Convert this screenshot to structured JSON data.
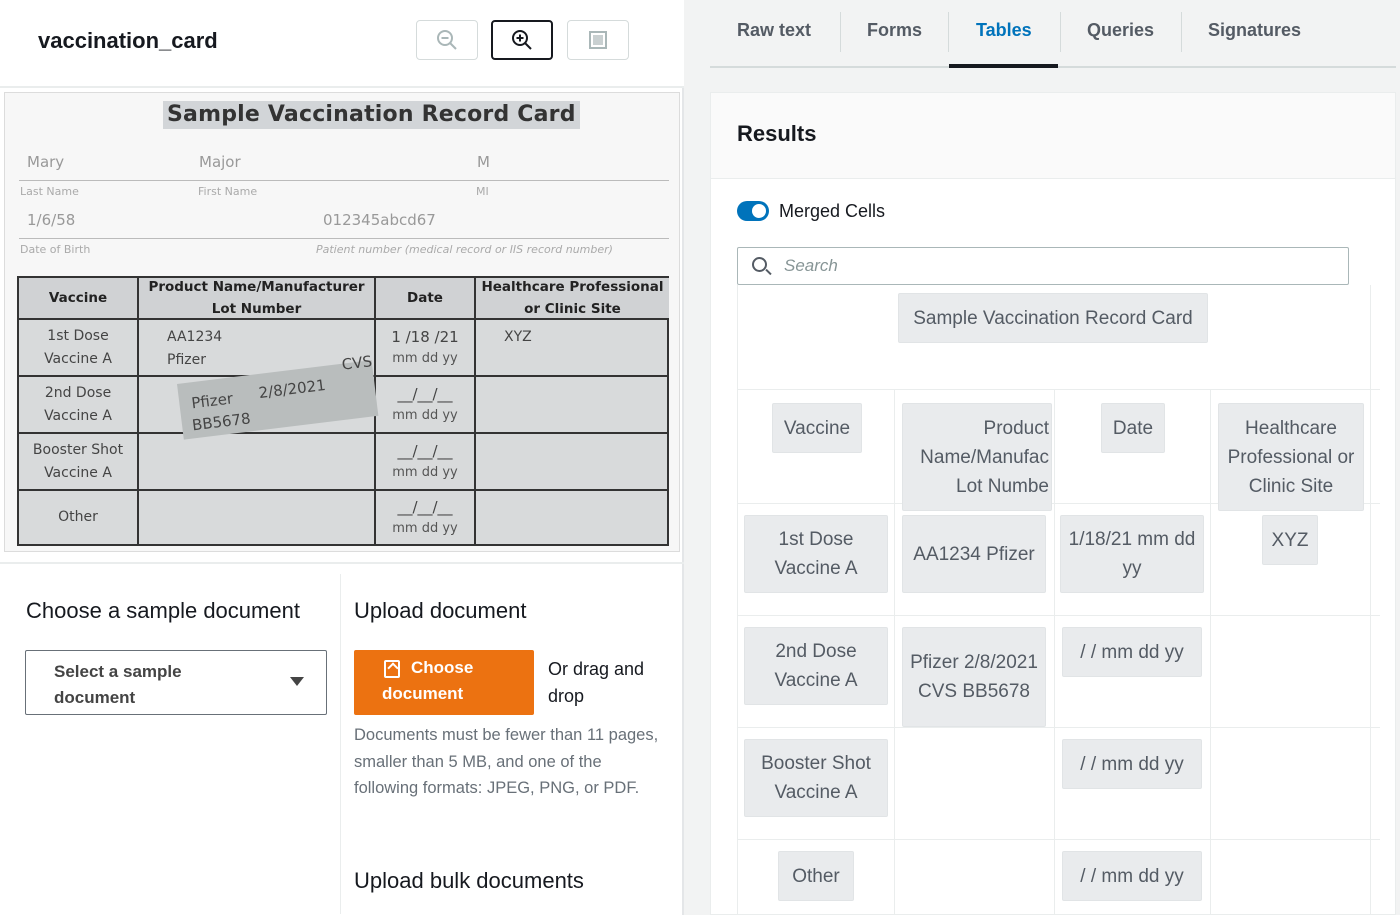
{
  "document": {
    "name": "vaccination_card",
    "toolbar": {
      "zoom_out_icon": "zoom-out-icon",
      "zoom_in_icon": "zoom-in-icon",
      "fit_icon": "fit-page-icon"
    }
  },
  "card": {
    "title": "Sample Vaccination Record Card",
    "last_name_value": "Mary",
    "first_name_value": "Major",
    "mi_value": "M",
    "last_name_label": "Last Name",
    "first_name_label": "First Name",
    "mi_label": "MI",
    "dob_value": "1/6/58",
    "patient_number_value": "012345abcd67",
    "dob_label": "Date of Birth",
    "patient_number_label": "Patient number (medical record or IIS record number)",
    "headers": {
      "vaccine": "Vaccine",
      "product_line1": "Product Name/Manufacturer",
      "product_line2": "Lot Number",
      "date": "Date",
      "hcp_line1": "Healthcare Professional",
      "hcp_line2": "or Clinic Site"
    },
    "rows": [
      {
        "vaccine_l1": "1st Dose",
        "vaccine_l2": "Vaccine A",
        "product_l1": "AA1234",
        "product_l2": "Pfizer",
        "date_l1": "1 /18 /21",
        "date_l2": "mm dd  yy",
        "site": "XYZ"
      },
      {
        "vaccine_l1": "2nd Dose",
        "vaccine_l2": "Vaccine A",
        "product_l1": "",
        "product_l2": "",
        "date_l1": "__/__/__",
        "date_l2": "mm dd  yy",
        "site": ""
      },
      {
        "vaccine_l1": "Booster Shot",
        "vaccine_l2": "Vaccine A",
        "product_l1": "",
        "product_l2": "",
        "date_l1": "__/__/__",
        "date_l2": "mm dd  yy",
        "site": ""
      },
      {
        "vaccine_l1": "Other",
        "vaccine_l2": "",
        "product_l1": "",
        "product_l2": "",
        "date_l1": "__/__/__",
        "date_l2": "mm dd  yy",
        "site": ""
      }
    ],
    "sticker": {
      "brand": "Pfizer",
      "date": "2/8/2021",
      "site": "CVS",
      "lot": "BB5678"
    }
  },
  "sample": {
    "heading": "Choose a sample document",
    "select_placeholder": "Select a sample document"
  },
  "upload": {
    "heading": "Upload document",
    "choose_label_1": "Choose",
    "choose_label_2": "document",
    "drag_text": "Or drag and drop",
    "help_text": "Documents must be fewer than 11 pages, smaller than 5 MB, and one of the following formats: JPEG, PNG, or PDF.",
    "bulk_heading": "Upload bulk documents"
  },
  "tabs": [
    {
      "label": "Raw text"
    },
    {
      "label": "Forms"
    },
    {
      "label": "Tables",
      "active": true
    },
    {
      "label": "Queries"
    },
    {
      "label": "Signatures"
    }
  ],
  "results": {
    "title": "Results",
    "merged_cells_label": "Merged Cells",
    "merged_cells_on": true,
    "search_placeholder": "Search",
    "table": {
      "title": "Sample Vaccination Record Card",
      "header": [
        "Vaccine",
        "Product Name/Manufac Lot Numbe",
        "Date",
        "Healthcare Professional or Clinic Site"
      ],
      "rows": [
        [
          "1st Dose Vaccine A",
          "AA1234 Pfizer",
          "1/18/21 mm dd yy",
          "XYZ"
        ],
        [
          "2nd Dose Vaccine A",
          "Pfizer 2/8/2021 CVS BB5678",
          "/ / mm dd yy",
          ""
        ],
        [
          "Booster Shot Vaccine A",
          "",
          "/ / mm dd yy",
          ""
        ],
        [
          "Other",
          "",
          "/ / mm dd yy",
          ""
        ]
      ]
    }
  },
  "colors": {
    "accent": "#0073bb",
    "primary_button": "#ec7211"
  }
}
